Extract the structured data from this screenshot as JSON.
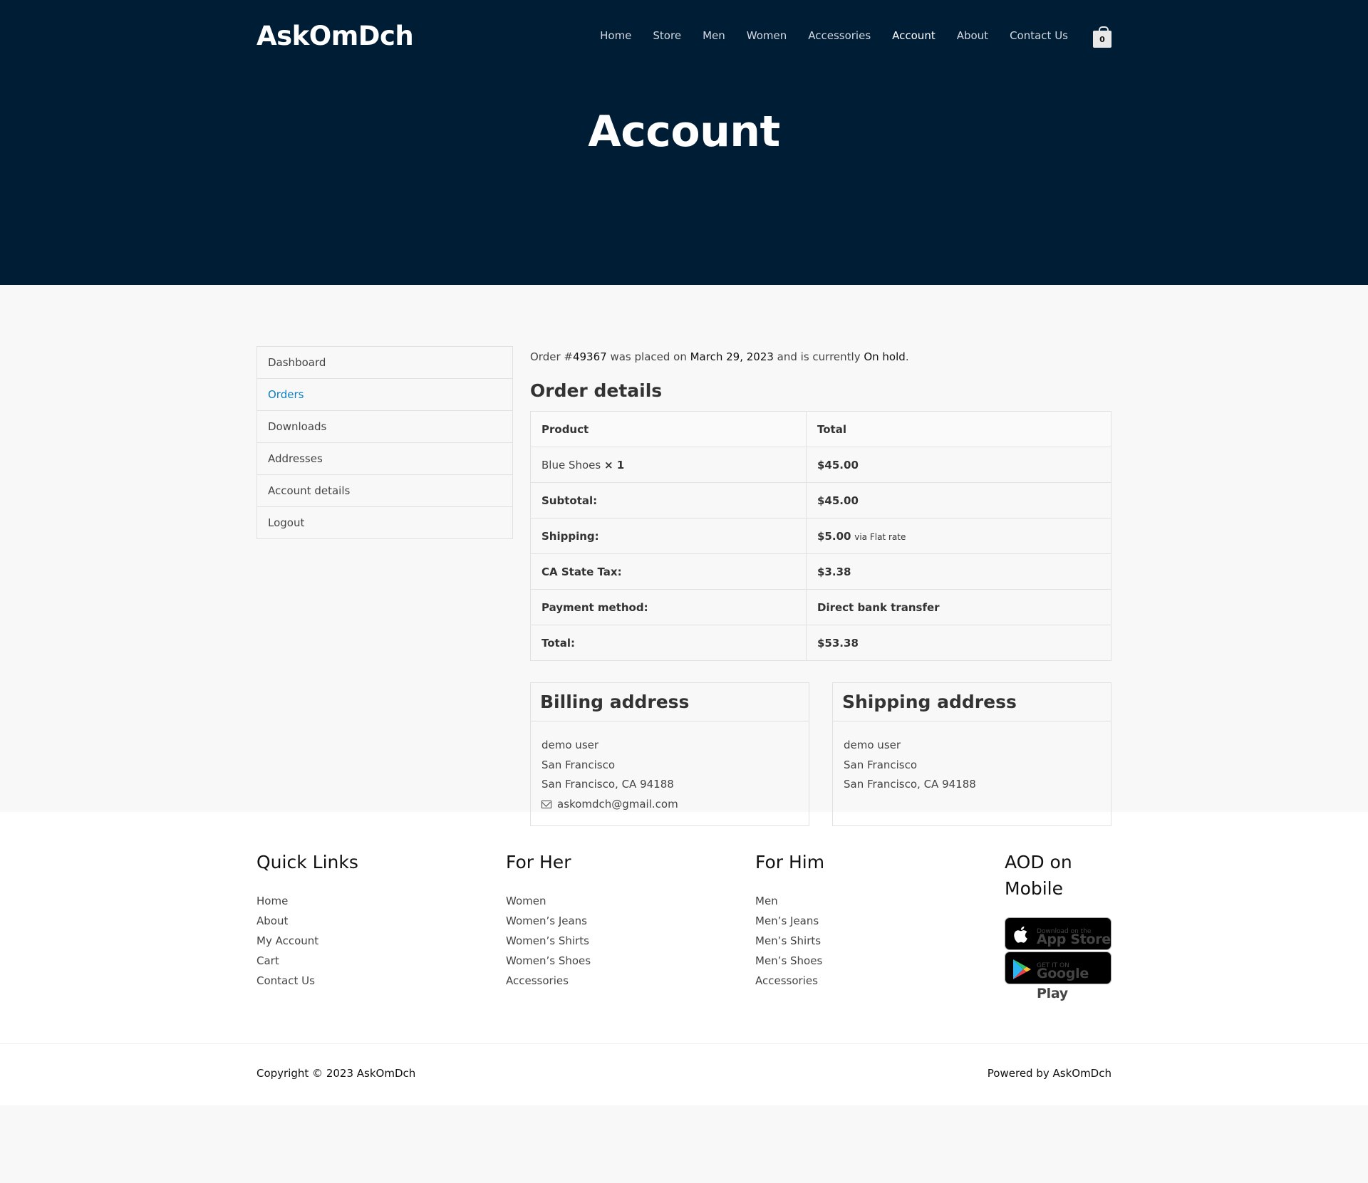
{
  "header": {
    "logo": "AskOmDch",
    "nav": [
      "Home",
      "Store",
      "Men",
      "Women",
      "Accessories",
      "Account",
      "About",
      "Contact Us"
    ],
    "cart_count": "0"
  },
  "hero": {
    "title": "Account"
  },
  "account_nav": [
    "Dashboard",
    "Orders",
    "Downloads",
    "Addresses",
    "Account details",
    "Logout"
  ],
  "order": {
    "intro_prefix": "Order #",
    "number": "49367",
    "intro_mid": " was placed on ",
    "date": "March 29, 2023",
    "intro_mid2": " and is currently ",
    "status": "On hold",
    "intro_end": ".",
    "details_title": "Order details",
    "header": {
      "product": "Product",
      "total": "Total"
    },
    "item": {
      "name": "Blue Shoes",
      "qty": "× 1",
      "total": "$45.00"
    },
    "rows": [
      {
        "label": "Subtotal:",
        "value": "$45.00",
        "note": ""
      },
      {
        "label": "Shipping:",
        "value": "$5.00",
        "note": "via Flat rate"
      },
      {
        "label": "CA State Tax:",
        "value": "$3.38",
        "note": ""
      },
      {
        "label": "Payment method:",
        "value": "Direct bank transfer",
        "note": ""
      },
      {
        "label": "Total:",
        "value": "$53.38",
        "note": ""
      }
    ]
  },
  "billing": {
    "title": "Billing address",
    "name": "demo user",
    "line1": "San Francisco",
    "line2": "San Francisco, CA 94188",
    "email": "askomdch@gmail.com"
  },
  "shipping": {
    "title": "Shipping address",
    "name": "demo user",
    "line1": "San Francisco",
    "line2": "San Francisco, CA 94188"
  },
  "footer": {
    "quick_links": {
      "title": "Quick Links",
      "links": [
        "Home",
        "About",
        "My Account",
        "Cart",
        "Contact Us"
      ]
    },
    "for_her": {
      "title": "For Her",
      "links": [
        "Women",
        "Women’s Jeans",
        "Women’s Shirts",
        "Women’s Shoes",
        "Accessories"
      ]
    },
    "for_him": {
      "title": "For Him",
      "links": [
        "Men",
        "Men’s Jeans",
        "Men’s Shirts",
        "Men’s Shoes",
        "Accessories"
      ]
    },
    "mobile": {
      "title": "AOD on Mobile",
      "app_store_sub": "Download on the",
      "app_store": "App Store",
      "google_sub": "GET IT ON",
      "google": "Google Play"
    },
    "copyright": "Copyright © 2023 AskOmDch",
    "powered": "Powered by AskOmDch"
  },
  "colors": {
    "header_bg": "#001d36",
    "active_link": "#0a7fc1"
  }
}
